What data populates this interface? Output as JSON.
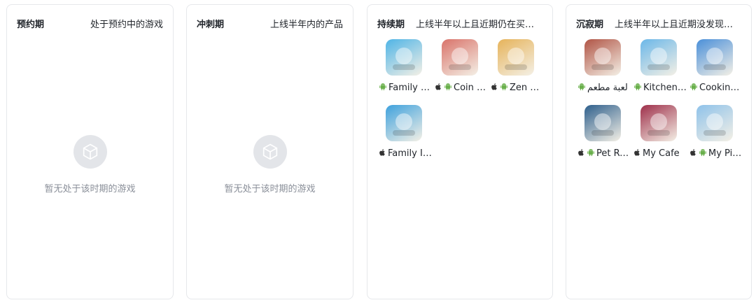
{
  "panels": [
    {
      "title": "预约期",
      "desc": "处于预约中的游戏",
      "empty": "暂无处于该时期的游戏"
    },
    {
      "title": "冲刺期",
      "desc": "上线半年内的产品",
      "empty": "暂无处于该时期的游戏"
    },
    {
      "title": "持续期",
      "desc": "上线半年以上且近期仍在买量的游戏"
    },
    {
      "title": "沉寂期",
      "desc": "上线半年以上且近期没发现买量的游戏"
    }
  ],
  "sustained_games": [
    {
      "name": "Family Island",
      "platforms": [
        "android"
      ],
      "icon": "game-icon-family-island",
      "color": "#4fb4e6"
    },
    {
      "name": "Coin Master",
      "platforms": [
        "apple",
        "android"
      ],
      "icon": "game-icon-coin-master",
      "color": "#d9736a"
    },
    {
      "name": "Zen Match",
      "platforms": [
        "apple",
        "android"
      ],
      "icon": "game-icon-zen",
      "color": "#e6b35a"
    },
    {
      "name": "Family Island",
      "platforms": [
        "apple"
      ],
      "icon": "game-icon-family-island-2",
      "color": "#3ea1dd"
    }
  ],
  "dormant_games": [
    {
      "name": "لعبة مطعم",
      "platforms": [
        "android"
      ],
      "icon": "game-icon-drink",
      "color": "#b05445"
    },
    {
      "name": "Kitchen Fever",
      "platforms": [
        "android"
      ],
      "icon": "game-icon-kitchen",
      "color": "#6bb7e8"
    },
    {
      "name": "Cooking Madness",
      "platforms": [
        "android"
      ],
      "icon": "game-icon-cooking",
      "color": "#4a8fd9"
    },
    {
      "name": "Pet Rescue",
      "platforms": [
        "apple",
        "android"
      ],
      "icon": "game-icon-raccoon",
      "color": "#2e5f8c"
    },
    {
      "name": "My Cafe",
      "platforms": [
        "apple"
      ],
      "icon": "game-icon-cafe",
      "color": "#9e2f4a"
    },
    {
      "name": "My Pizzeria",
      "platforms": [
        "apple",
        "android"
      ],
      "icon": "game-icon-pizzeria",
      "color": "#8ec2ea"
    }
  ]
}
